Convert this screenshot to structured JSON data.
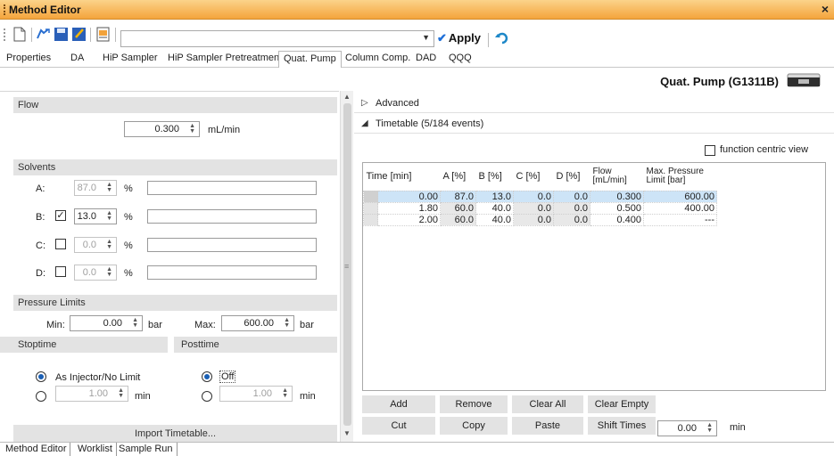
{
  "window": {
    "title": "Method Editor",
    "close_glyph": "×"
  },
  "toolbar": {
    "method_combo_value": "",
    "apply_label": "Apply",
    "icons": [
      "new-document-icon",
      "open-icon",
      "save-icon",
      "save-as-icon",
      "report-icon",
      "undo-icon"
    ]
  },
  "tabs": [
    "Properties",
    "DA",
    "HiP Sampler",
    "HiP Sampler Pretreatment",
    "Quat. Pump",
    "Column Comp.",
    "DAD",
    "QQQ"
  ],
  "active_tab": "Quat. Pump",
  "module": {
    "title": "Quat. Pump (G1311B)"
  },
  "flow": {
    "section": "Flow",
    "value": "0.300",
    "unit": "mL/min"
  },
  "solvents": {
    "section": "Solvents",
    "rows": [
      {
        "label": "A:",
        "checked": null,
        "value": "87.0",
        "unit": "%",
        "enabled": false
      },
      {
        "label": "B:",
        "checked": true,
        "value": "13.0",
        "unit": "%",
        "enabled": true
      },
      {
        "label": "C:",
        "checked": false,
        "value": "0.0",
        "unit": "%",
        "enabled": false
      },
      {
        "label": "D:",
        "checked": false,
        "value": "0.0",
        "unit": "%",
        "enabled": false
      }
    ]
  },
  "pressure": {
    "section": "Pressure Limits",
    "min_label": "Min:",
    "min": "0.00",
    "max_label": "Max:",
    "max": "600.00",
    "unit": "bar"
  },
  "stoptime": {
    "section": "Stoptime",
    "opt1": "As Injector/No Limit",
    "value": "1.00",
    "unit": "min"
  },
  "posttime": {
    "section": "Posttime",
    "opt1": "Off",
    "value": "1.00",
    "unit": "min"
  },
  "import_label": "Import Timetable...",
  "advanced_label": "Advanced",
  "timetable_label": "Timetable (5/184 events)",
  "function_centric_label": "function centric view",
  "timetable": {
    "headers": [
      "Time [min]",
      "A [%]",
      "B [%]",
      "C [%]",
      "D [%]",
      "Flow [mL/min]",
      "Max. Pressure Limit [bar]"
    ],
    "rows": [
      [
        "0.00",
        "87.0",
        "13.0",
        "0.0",
        "0.0",
        "0.300",
        "600.00"
      ],
      [
        "1.80",
        "60.0",
        "40.0",
        "0.0",
        "0.0",
        "0.500",
        "400.00"
      ],
      [
        "2.00",
        "60.0",
        "40.0",
        "0.0",
        "0.0",
        "0.400",
        "---"
      ]
    ]
  },
  "table_buttons": {
    "add": "Add",
    "remove": "Remove",
    "clear_all": "Clear All",
    "clear_empty": "Clear Empty",
    "cut": "Cut",
    "copy": "Copy",
    "paste": "Paste",
    "shift_times": "Shift Times",
    "shift_value": "0.00",
    "shift_unit": "min"
  },
  "bottom_tabs": [
    "Method Editor",
    "Worklist",
    "Sample Run"
  ]
}
